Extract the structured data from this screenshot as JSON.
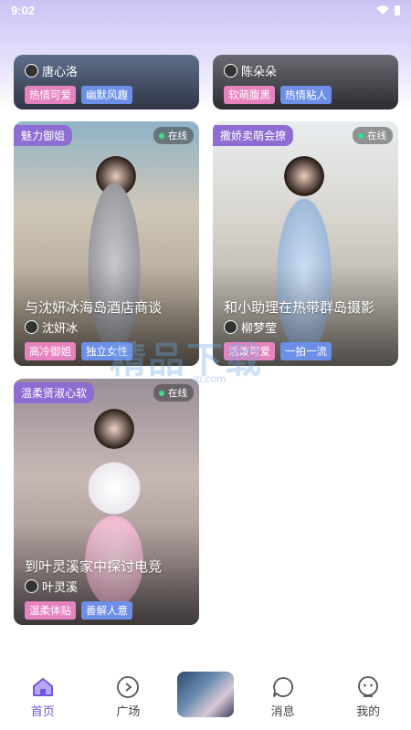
{
  "status_bar": {
    "time": "9:02"
  },
  "partial_cards": [
    {
      "host": "唐心洛",
      "tags": [
        "热情可爱",
        "幽默风趣"
      ]
    },
    {
      "host": "陈朵朵",
      "tags": [
        "软萌腹黑",
        "热情粘人"
      ]
    }
  ],
  "cards": [
    {
      "category": "魅力御姐",
      "online": "在线",
      "title": "与沈妍冰海岛酒店商谈",
      "host": "沈妍冰",
      "tags": [
        "高冷御姐",
        "独立女性"
      ]
    },
    {
      "category": "撒娇卖萌会撩",
      "online": "在线",
      "title": "和小助理在热带群岛摄影",
      "host": "柳梦莹",
      "tags": [
        "活泼可爱",
        "一拍一流"
      ]
    },
    {
      "category": "温柔贤淑心软",
      "online": "在线",
      "title": "到叶灵溪家中探讨电竞",
      "host": "叶灵溪",
      "tags": [
        "温柔体贴",
        "善解人意"
      ]
    }
  ],
  "nav": {
    "home": "首页",
    "plaza": "广场",
    "messages": "消息",
    "mine": "我的"
  },
  "watermark": {
    "main": "精品下载",
    "sub": "jp.com"
  },
  "colors": {
    "accent": "#6f58e0",
    "badge": "#8e6dd3",
    "tag_pink": "#e583bf",
    "tag_blue": "#6d8fe7"
  }
}
